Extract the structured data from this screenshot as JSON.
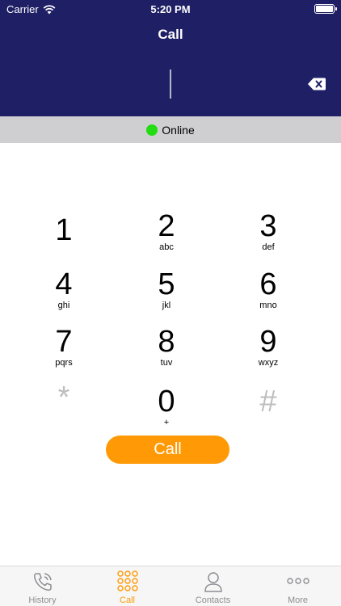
{
  "status_bar": {
    "carrier": "Carrier",
    "time": "5:20 PM"
  },
  "header": {
    "title": "Call",
    "number_value": ""
  },
  "connection": {
    "status": "Online",
    "status_color": "#22dd11"
  },
  "keypad": {
    "keys": [
      {
        "digit": "1",
        "letters": ""
      },
      {
        "digit": "2",
        "letters": "abc"
      },
      {
        "digit": "3",
        "letters": "def"
      },
      {
        "digit": "4",
        "letters": "ghi"
      },
      {
        "digit": "5",
        "letters": "jkl"
      },
      {
        "digit": "6",
        "letters": "mno"
      },
      {
        "digit": "7",
        "letters": "pqrs"
      },
      {
        "digit": "8",
        "letters": "tuv"
      },
      {
        "digit": "9",
        "letters": "wxyz"
      },
      {
        "digit": "*",
        "letters": ""
      },
      {
        "digit": "0",
        "letters": "+"
      },
      {
        "digit": "#",
        "letters": ""
      }
    ]
  },
  "call_button": {
    "label": "Call",
    "color": "#ff9a06"
  },
  "tabs": [
    {
      "label": "History",
      "icon": "phone-history-icon"
    },
    {
      "label": "Call",
      "icon": "keypad-icon",
      "active": true
    },
    {
      "label": "Contacts",
      "icon": "contact-person-icon"
    },
    {
      "label": "More",
      "icon": "more-dots-icon"
    }
  ],
  "colors": {
    "header": "#1f1f66",
    "accent": "#ff9a06",
    "online_bar": "#cfcfd1"
  }
}
